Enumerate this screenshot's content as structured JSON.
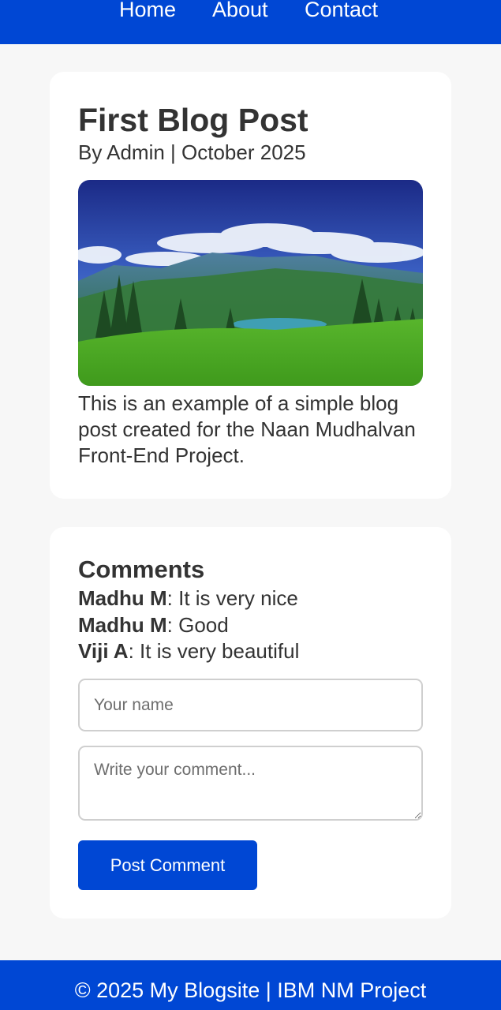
{
  "nav": {
    "items": [
      {
        "label": "Home"
      },
      {
        "label": "About"
      },
      {
        "label": "Contact"
      }
    ]
  },
  "post": {
    "title": "First Blog Post",
    "meta": "By Admin | October 2025",
    "image_subject": "mountain-landscape",
    "body": "This is an example of a simple blog post created for the Naan Mudhalvan Front-End Project."
  },
  "comments": {
    "heading": "Comments",
    "items": [
      {
        "author": "Madhu M",
        "separator": ":",
        "text": " It is very nice"
      },
      {
        "author": "Madhu M",
        "separator": ":",
        "text": " Good"
      },
      {
        "author": "Viji A",
        "separator": ":",
        "text": " It is very beautiful"
      }
    ],
    "name_placeholder": "Your name",
    "comment_placeholder": "Write your comment...",
    "submit_label": "Post Comment"
  },
  "footer": {
    "text": "© 2025 My Blogsite | IBM NM Project"
  },
  "colors": {
    "brand_blue": "#0047d4",
    "page_background": "#f7f7f7",
    "card_background": "#ffffff",
    "text": "#333333"
  }
}
